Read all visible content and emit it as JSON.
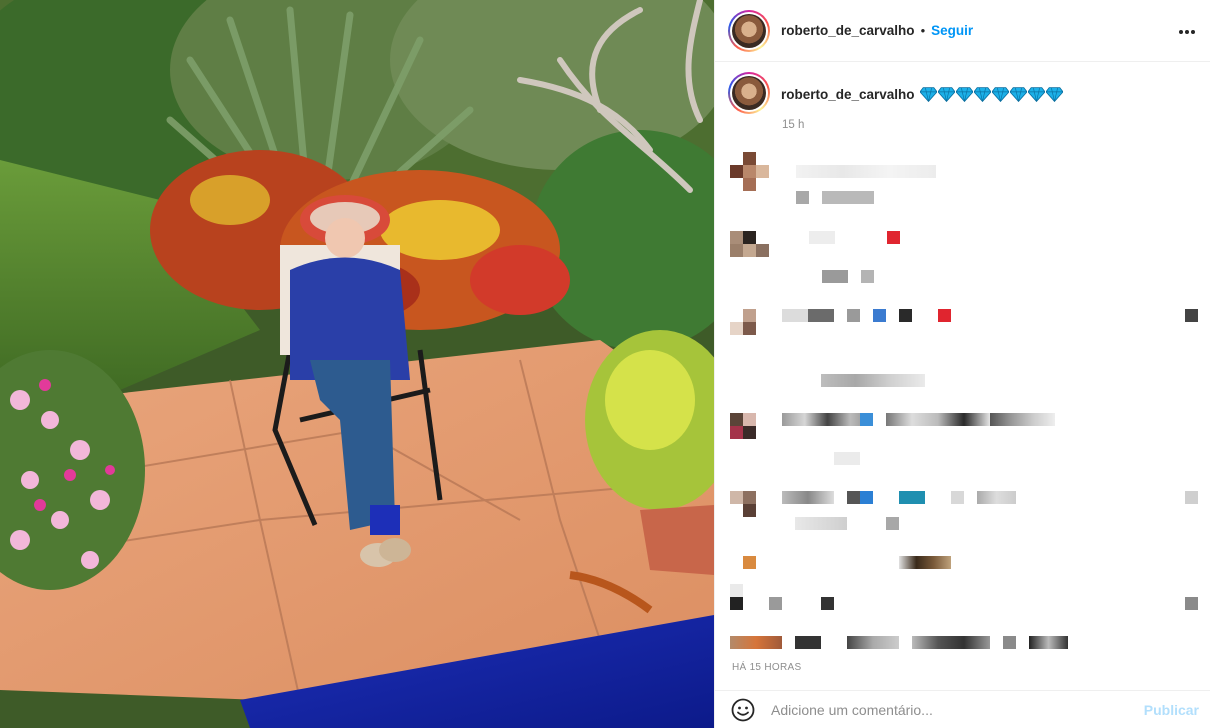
{
  "post": {
    "author": "roberto_de_carvalho",
    "follow_label": "Seguir",
    "separator": "•",
    "more_icon": "more-horizontal-icon",
    "photo_icon": "garden-photo"
  },
  "caption": {
    "author": "roberto_de_carvalho",
    "emoji": [
      "💎",
      "💎",
      "💎",
      "💎",
      "💎",
      "💎",
      "💎",
      "💎"
    ],
    "time": "15 h"
  },
  "footer": {
    "timestamp": "HÁ 15 HORAS",
    "comment_placeholder": "Adicione um comentário...",
    "publish_label": "Publicar",
    "emoji_icon": "smiley-icon"
  },
  "colors": {
    "accent": "#0095f6",
    "publish_disabled": "#b2dffc",
    "muted": "#8e8e8e",
    "gem": "#1cb0e8"
  }
}
